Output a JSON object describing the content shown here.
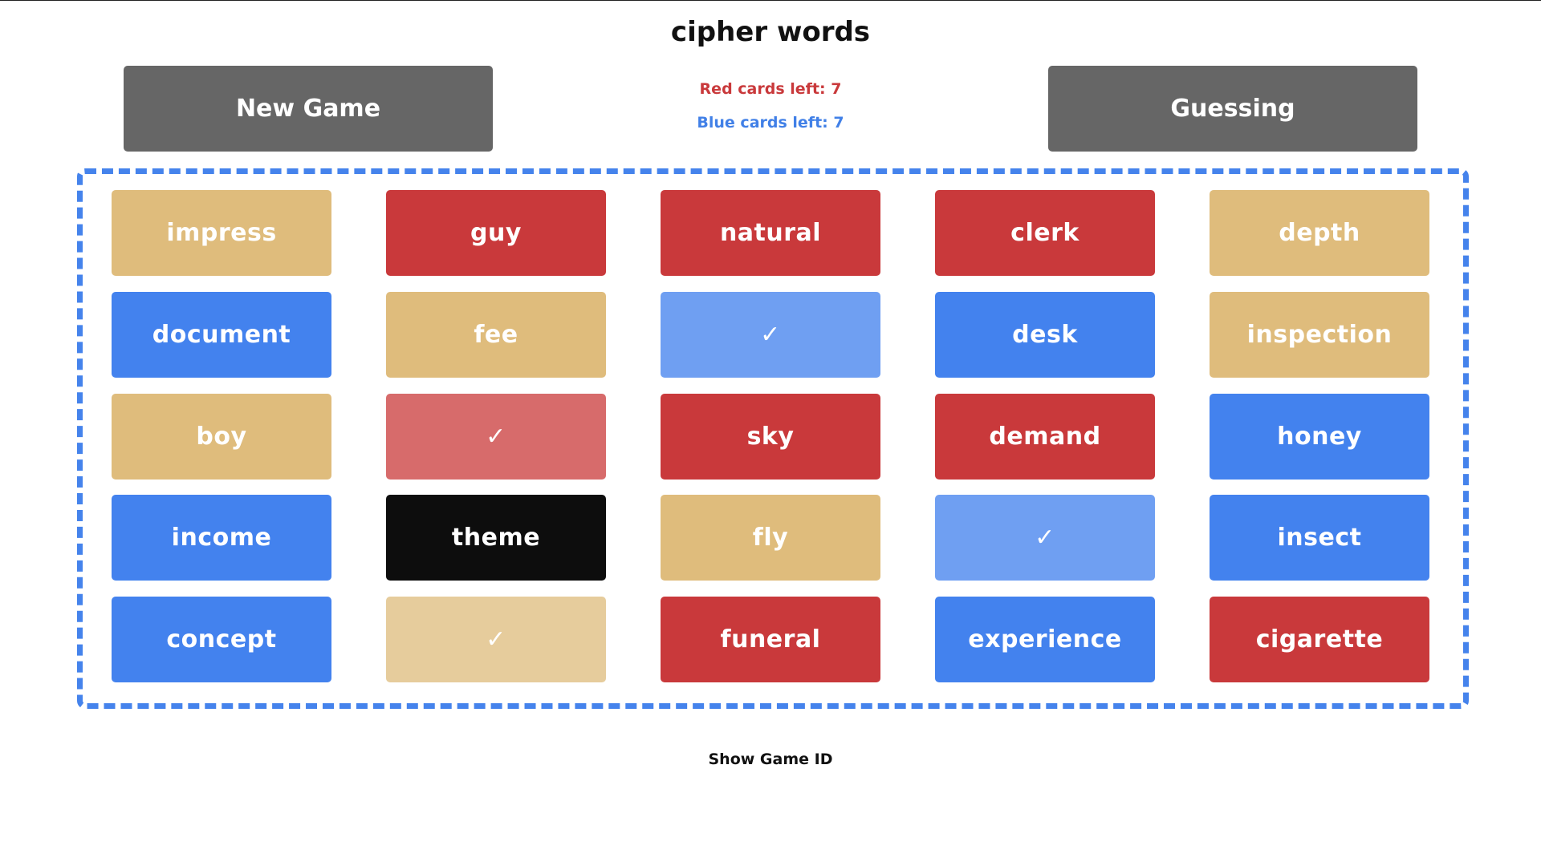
{
  "title": "cipher words",
  "controls": {
    "new_game_label": "New Game",
    "mode_label": "Guessing"
  },
  "status": {
    "red_left": "Red cards left: 7",
    "blue_left": "Blue cards left: 7"
  },
  "colors": {
    "red": "#c9393b",
    "blue": "#4382ee",
    "neutral": "#dfbc7c",
    "assassin": "#0d0d0d",
    "red_revealed": "#d76b6b",
    "blue_revealed": "#6f9ff2",
    "neutral_revealed": "#e6cc9c",
    "board_border": "#4583ec",
    "button_gray": "#666666"
  },
  "revealed_mark": "✓",
  "cards": [
    {
      "word": "impress",
      "team": "neutral",
      "revealed": false
    },
    {
      "word": "guy",
      "team": "red",
      "revealed": false
    },
    {
      "word": "natural",
      "team": "red",
      "revealed": false
    },
    {
      "word": "clerk",
      "team": "red",
      "revealed": false
    },
    {
      "word": "depth",
      "team": "neutral",
      "revealed": false
    },
    {
      "word": "document",
      "team": "blue",
      "revealed": false
    },
    {
      "word": "fee",
      "team": "neutral",
      "revealed": false
    },
    {
      "word": "",
      "team": "blue",
      "revealed": true
    },
    {
      "word": "desk",
      "team": "blue",
      "revealed": false
    },
    {
      "word": "inspection",
      "team": "neutral",
      "revealed": false
    },
    {
      "word": "boy",
      "team": "neutral",
      "revealed": false
    },
    {
      "word": "",
      "team": "red",
      "revealed": true
    },
    {
      "word": "sky",
      "team": "red",
      "revealed": false
    },
    {
      "word": "demand",
      "team": "red",
      "revealed": false
    },
    {
      "word": "honey",
      "team": "blue",
      "revealed": false
    },
    {
      "word": "income",
      "team": "blue",
      "revealed": false
    },
    {
      "word": "theme",
      "team": "black",
      "revealed": false
    },
    {
      "word": "fly",
      "team": "neutral",
      "revealed": false
    },
    {
      "word": "",
      "team": "blue",
      "revealed": true
    },
    {
      "word": "insect",
      "team": "blue",
      "revealed": false
    },
    {
      "word": "concept",
      "team": "blue",
      "revealed": false
    },
    {
      "word": "",
      "team": "neutral",
      "revealed": true
    },
    {
      "word": "funeral",
      "team": "red",
      "revealed": false
    },
    {
      "word": "experience",
      "team": "blue",
      "revealed": false
    },
    {
      "word": "cigarette",
      "team": "red",
      "revealed": false
    }
  ],
  "footer": {
    "show_game_id_label": "Show Game ID"
  }
}
